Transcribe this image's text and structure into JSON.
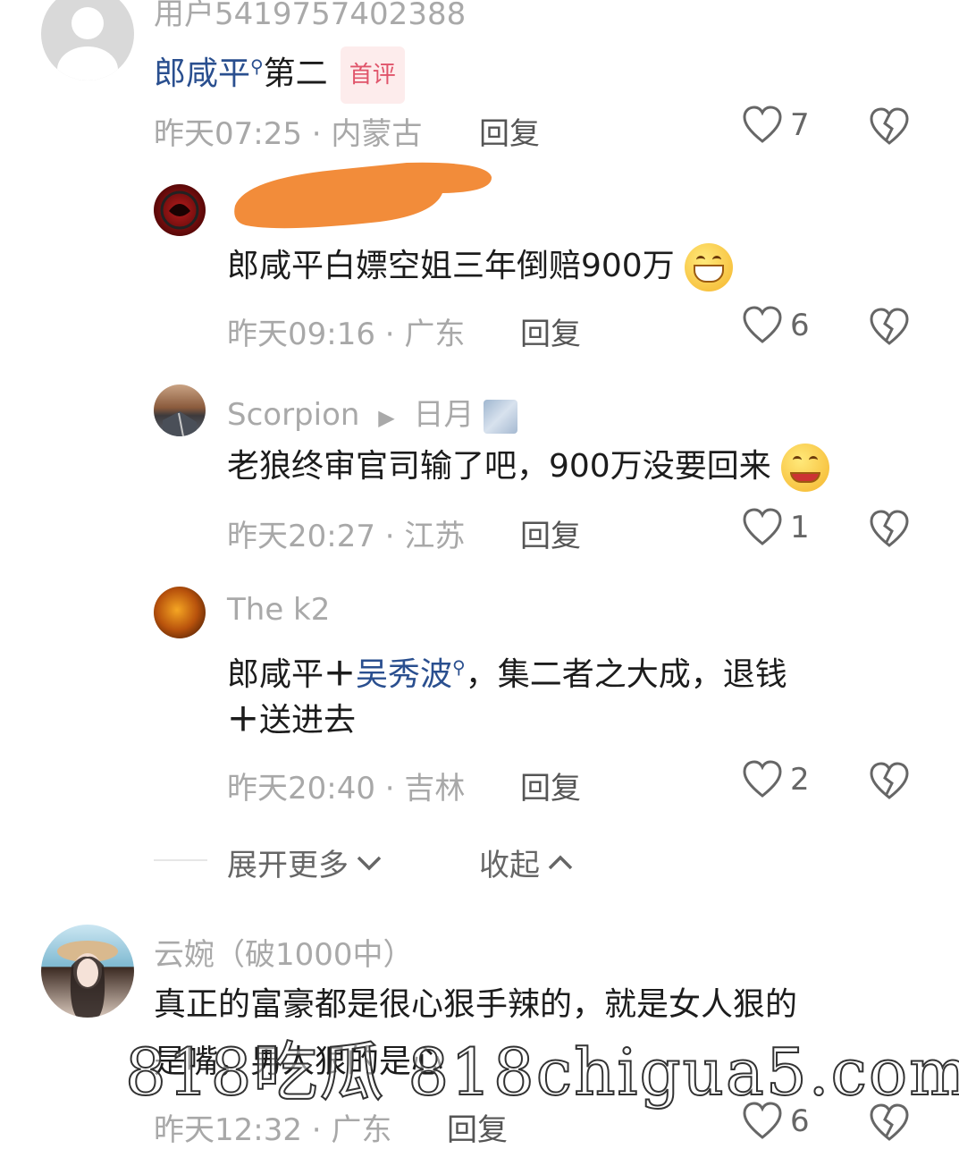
{
  "comments": [
    {
      "username": "用户5419757402388",
      "text_prefix": "郎咸平",
      "text_rest": "第二",
      "badge": "首评",
      "meta": "昨天07:25 · 内蒙古",
      "reply": "回复",
      "likes": "7"
    },
    {
      "username": "",
      "text": "郎咸平白嫖空姐三年倒赔900万",
      "emoji": "grin-emoji",
      "meta": "昨天09:16 · 广东",
      "reply": "回复",
      "likes": "6"
    },
    {
      "username": "Scorpion",
      "reply_to": "日月",
      "text": "老狼终审官司输了吧，900万没要回来",
      "emoji": "smile-emoji",
      "meta": "昨天20:27 · 江苏",
      "reply": "回复",
      "likes": "1"
    },
    {
      "username": "The k2",
      "text_part1": "郎咸平",
      "plus": "＋",
      "text_link": "吴秀波",
      "text_part2": "，集二者之大成，退钱",
      "text_line2_plus": "＋",
      "text_line2": "送进去",
      "meta": "昨天20:40 · 吉林",
      "reply": "回复",
      "likes": "2"
    },
    {
      "username": "云婉（破1000中）",
      "text_line1": "真正的富豪都是很心狠手辣的，就是女人狠的",
      "text_line2": "是嘴，男人狠的是心",
      "meta": "昨天12:32 · 广东",
      "reply": "回复",
      "likes": "6"
    }
  ],
  "expand_more": "展开更多",
  "collapse": "收起",
  "watermark": "818吃瓜  818chigua5.com",
  "colors": {
    "link": "#2a4f8f",
    "badge_bg": "#fdecec",
    "badge_text": "#e0546a",
    "redaction": "#f28c3a"
  }
}
